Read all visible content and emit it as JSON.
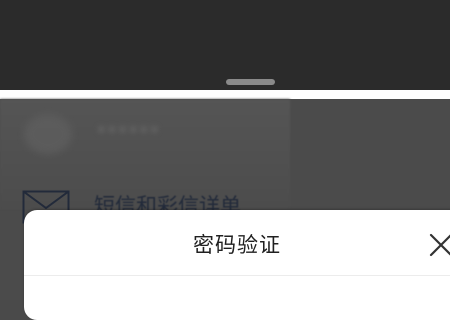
{
  "top_panel": {
    "handle_icon": "drag-handle"
  },
  "background_screen": {
    "blurred_title": "••••••",
    "menu_item_label": "短信和彩信详单",
    "menu_item_icon": "mail-icon"
  },
  "dialog": {
    "title": "密码验证",
    "close_icon": "close-icon"
  }
}
